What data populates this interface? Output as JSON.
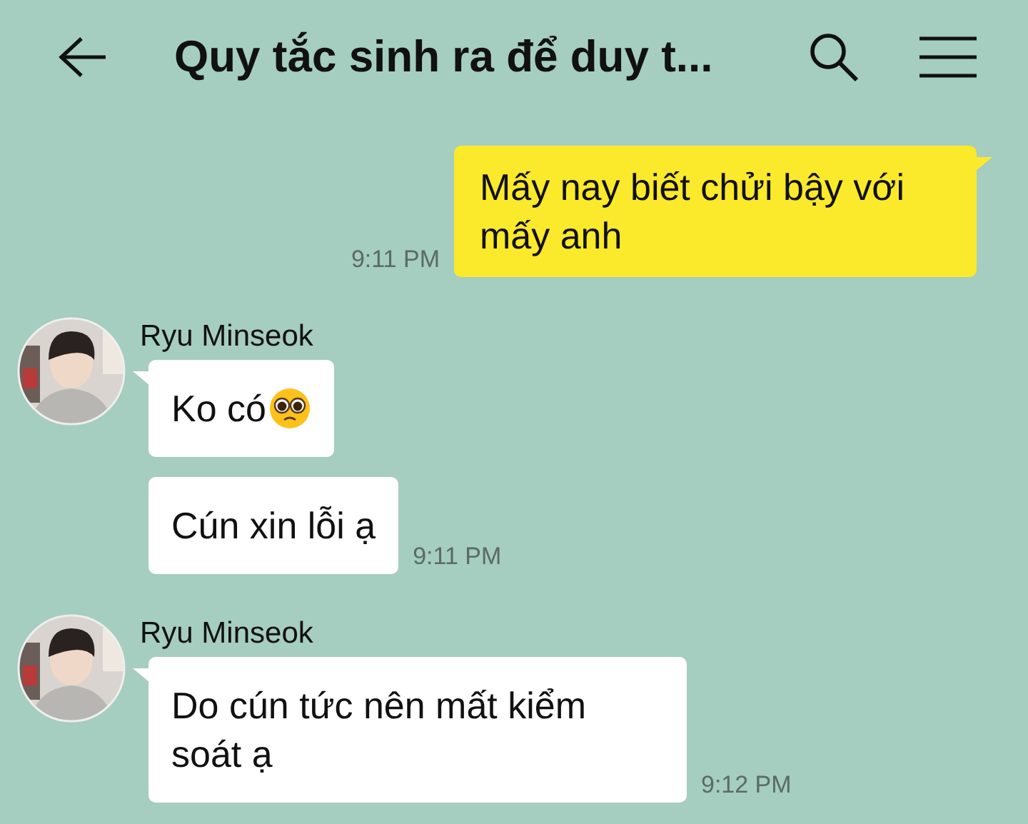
{
  "header": {
    "title": "Quy tắc sinh ra để duy t..."
  },
  "groups": [
    {
      "kind": "outgoing",
      "messages": [
        {
          "text": "Mấy nay biết chửi bậy với mấy anh",
          "time": "9:11 PM"
        }
      ]
    },
    {
      "kind": "incoming",
      "sender": "Ryu Minseok",
      "avatar": {
        "kind": "picture"
      },
      "messages": [
        {
          "kind": "text_emoji",
          "text": "Ko có"
        },
        {
          "kind": "text",
          "text": "Cún xin lỗi ạ",
          "time": "9:11 PM"
        }
      ]
    },
    {
      "kind": "incoming",
      "sender": "Ryu Minseok",
      "avatar": {
        "kind": "picture"
      },
      "messages": [
        {
          "text": "Do cún tức nên mất kiểm soát ạ",
          "time": "9:12 PM"
        }
      ]
    }
  ]
}
